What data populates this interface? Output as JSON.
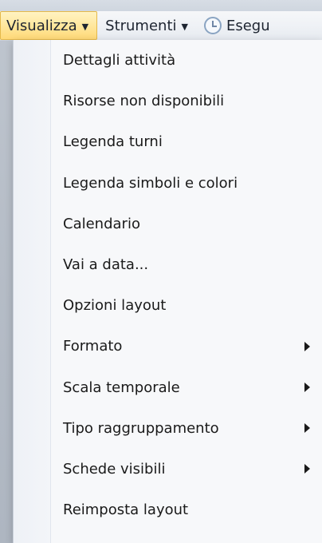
{
  "menubar": {
    "items": [
      {
        "label": "Visualizza"
      },
      {
        "label": "Strumenti"
      },
      {
        "label": "Esegu"
      }
    ]
  },
  "dropdown": {
    "items": [
      {
        "label": "Dettagli attività",
        "has_submenu": false
      },
      {
        "label": "Risorse non disponibili",
        "has_submenu": false
      },
      {
        "label": "Legenda turni",
        "has_submenu": false
      },
      {
        "label": "Legenda simboli e colori",
        "has_submenu": false
      },
      {
        "label": "Calendario",
        "has_submenu": false
      },
      {
        "label": "Vai a data...",
        "has_submenu": false
      },
      {
        "label": "Opzioni layout",
        "has_submenu": false
      },
      {
        "label": "Formato",
        "has_submenu": true
      },
      {
        "label": "Scala temporale",
        "has_submenu": true
      },
      {
        "label": "Tipo raggruppamento",
        "has_submenu": true
      },
      {
        "label": "Schede visibili",
        "has_submenu": true
      },
      {
        "label": "Reimposta layout",
        "has_submenu": false
      }
    ]
  }
}
